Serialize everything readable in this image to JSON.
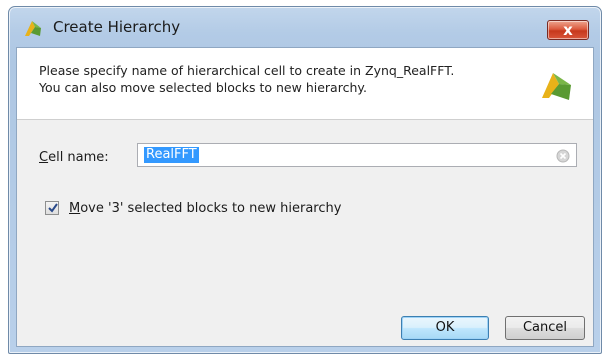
{
  "window": {
    "title": "Create Hierarchy",
    "close_glyph": "x"
  },
  "header": {
    "line1": "Please specify name of hierarchical cell to create in Zynq_RealFFT.",
    "line2": "You can also move selected blocks to new hierarchy."
  },
  "form": {
    "cell_label_accel": "C",
    "cell_label_rest": "ell name:",
    "cell_value": "RealFFT"
  },
  "checkbox": {
    "checked": true,
    "label_accel": "M",
    "label_rest": "ove '3' selected blocks to new hierarchy"
  },
  "buttons": {
    "ok_label": "OK",
    "cancel_label": "Cancel"
  },
  "colors": {
    "logo_green": "#7ab648",
    "logo_yellow": "#e8b219",
    "selection": "#3399ff",
    "close_red": "#c7381c"
  },
  "icons": {
    "app": "vivado-logo-icon",
    "close": "close-icon",
    "clear": "clear-input-icon",
    "check": "checkmark-icon"
  }
}
